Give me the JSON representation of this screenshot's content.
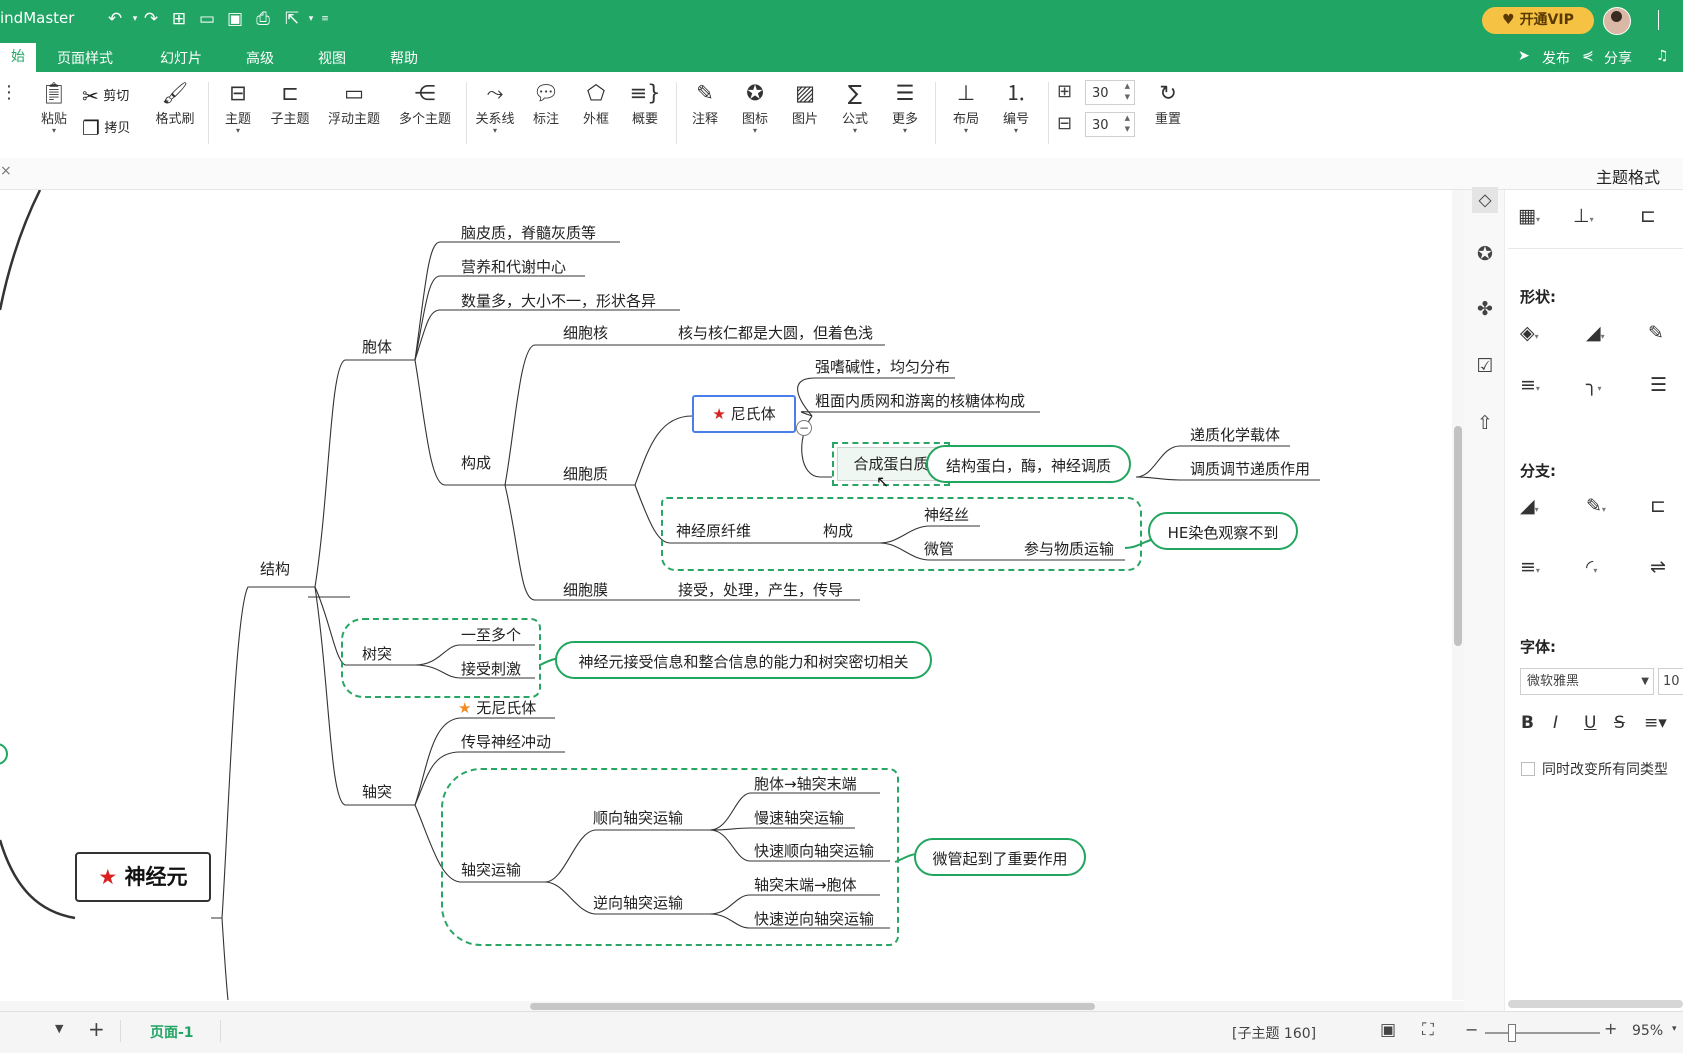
{
  "app": {
    "title": "indMaster"
  },
  "titlebar": {
    "vip_label": "开通VIP",
    "icons": [
      "undo-icon",
      "redo-icon",
      "new-icon",
      "open-icon",
      "save-icon",
      "print-icon",
      "export-icon",
      "more-icon"
    ]
  },
  "menu": {
    "active": "始",
    "items": [
      "页面样式",
      "幻灯片",
      "高级",
      "视图",
      "帮助"
    ],
    "publish": "发布",
    "share": "分享"
  },
  "toolbar": {
    "paste": "粘贴",
    "cut": "剪切",
    "copy": "拷贝",
    "format_brush": "格式刷",
    "topic": "主题",
    "subtopic": "子主题",
    "floating": "浮动主题",
    "multi": "多个主题",
    "relation": "关系线",
    "callout": "标注",
    "boundary": "外框",
    "summary": "概要",
    "note": "注释",
    "icon": "图标",
    "image": "图片",
    "formula": "公式",
    "more": "更多",
    "layout": "布局",
    "numbering": "编号",
    "reset": "重置",
    "spacing_h": "30",
    "spacing_v": "30"
  },
  "panel": {
    "title": "主题格式",
    "shape_label": "形状:",
    "branch_label": "分支:",
    "font_label": "字体:",
    "font_name": "微软雅黑",
    "font_size": "10",
    "same_type": "同时改变所有同类型",
    "format_buttons": [
      "B",
      "I",
      "U",
      "S"
    ]
  },
  "mindmap": {
    "root": "神经元",
    "structure": "结构",
    "soma": "胞体",
    "soma_items": [
      "脑皮质，脊髓灰质等",
      "营养和代谢中心",
      "数量多，大小不一，形状各异"
    ],
    "composition": "构成",
    "nucleus": "细胞核",
    "nucleus_desc": "核与核仁都是大圆，但着色浅",
    "cytoplasm": "细胞质",
    "nissl": "尼氏体",
    "nissl_items": [
      "强嗜碱性，均匀分布",
      "粗面内质网和游离的核糖体构成"
    ],
    "protein": "合成蛋白质",
    "protein_callout": "结构蛋白，酶，神经调质",
    "protein_sub": [
      "递质化学载体",
      "调质调节递质作用"
    ],
    "neurofibril": "神经原纤维",
    "neurofibril_comp": "构成",
    "neurofibril_items": [
      "神经丝",
      "微管"
    ],
    "transport": "参与物质运输",
    "he_callout": "HE染色观察不到",
    "membrane": "细胞膜",
    "membrane_desc": "接受，处理，产生，传导",
    "dendrite": "树突",
    "dendrite_items": [
      "一至多个",
      "接受刺激"
    ],
    "dendrite_callout": "神经元接受信息和整合信息的能力和树突密切相关",
    "axon": "轴突",
    "axon_items": [
      "无尼氏体",
      "传导神经冲动"
    ],
    "axon_transport": "轴突运输",
    "anterograde": "顺向轴突运输",
    "anterograde_items": [
      "胞体→轴突末端",
      "慢速轴突运输",
      "快速顺向轴突运输"
    ],
    "retrograde": "逆向轴突运输",
    "retrograde_items": [
      "轴突末端→胞体",
      "快速逆向轴突运输"
    ],
    "microtubule_callout": "微管起到了重要作用"
  },
  "status": {
    "page_tab": "页面-1",
    "selection": "[子主题 160]",
    "zoom": "95%"
  },
  "colors": {
    "brand": "#21a564",
    "callout_border": "#22a55f",
    "selection_blue": "#4a7ee8",
    "star_red": "#d92121",
    "star_orange": "#f08c22",
    "vip_gold": "#f5c243"
  }
}
